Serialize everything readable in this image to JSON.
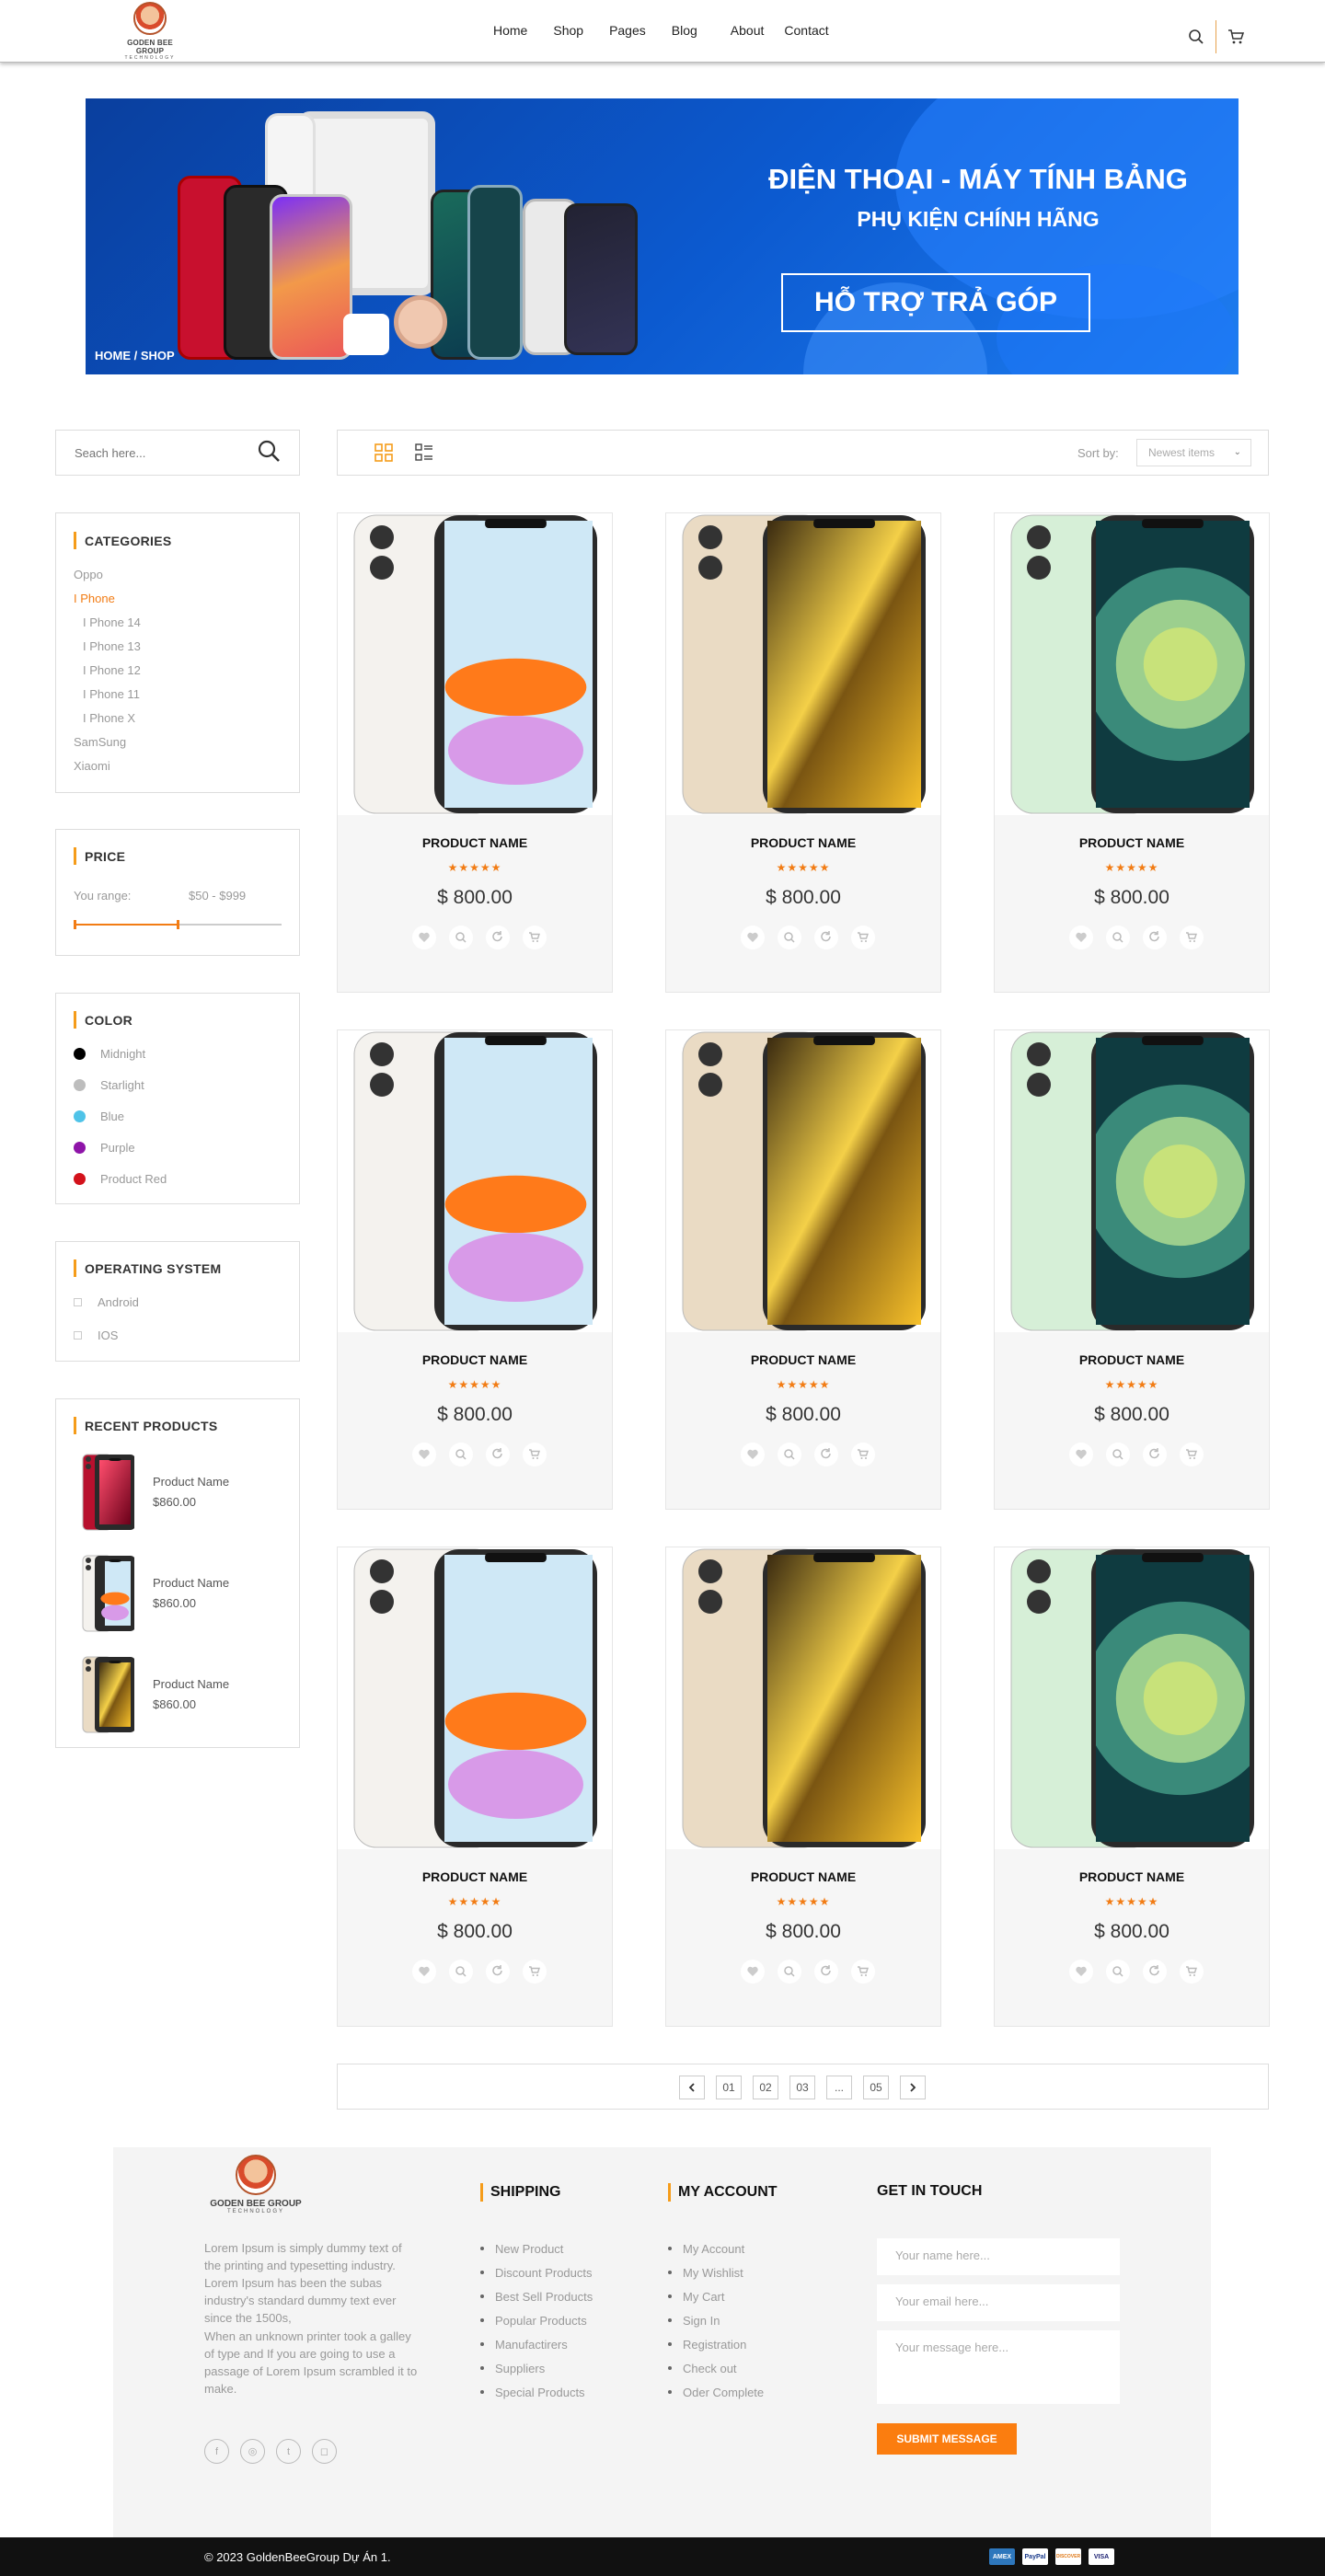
{
  "header": {
    "logo": {
      "name": "GODEN BEE GROUP",
      "sub": "TECHNOLOGY"
    },
    "nav": [
      "Home",
      "Shop",
      "Pages",
      "Blog",
      "About",
      "Contact"
    ]
  },
  "banner": {
    "title1": "ĐIỆN THOẠI - MÁY TÍNH BẢNG",
    "title2": "PHỤ KIỆN CHÍNH HÃNG",
    "button": "HỖ TRỢ TRẢ GÓP",
    "breadcrumb": "HOME / SHOP"
  },
  "search": {
    "placeholder": "Seach here..."
  },
  "categories": {
    "title": "CATEGORIES",
    "items": [
      {
        "label": "Oppo",
        "level": 0,
        "active": false
      },
      {
        "label": "I Phone",
        "level": 0,
        "active": true
      },
      {
        "label": "I Phone 14",
        "level": 1,
        "active": false
      },
      {
        "label": "I Phone 13",
        "level": 1,
        "active": false
      },
      {
        "label": "I Phone 12",
        "level": 1,
        "active": false
      },
      {
        "label": "I Phone 11",
        "level": 1,
        "active": false
      },
      {
        "label": "I Phone X",
        "level": 1,
        "active": false
      },
      {
        "label": "SamSung",
        "level": 0,
        "active": false
      },
      {
        "label": "Xiaomi",
        "level": 0,
        "active": false
      }
    ]
  },
  "price": {
    "title": "PRICE",
    "label": "You range:",
    "value": "$50 - $999",
    "slider_fraction": 0.5
  },
  "color": {
    "title": "COLOR",
    "items": [
      {
        "label": "Midnight",
        "color": "#000000"
      },
      {
        "label": "Starlight",
        "color": "#bdbdbd"
      },
      {
        "label": "Blue",
        "color": "#4fc3e8"
      },
      {
        "label": "Purple",
        "color": "#8e14a8"
      },
      {
        "label": "Product Red",
        "color": "#d3121b"
      }
    ]
  },
  "os": {
    "title": "OPERATING SYSTEM",
    "items": [
      "Android",
      "IOS"
    ]
  },
  "recent": {
    "title": "RECENT PRODUCTS",
    "items": [
      {
        "name": "Product Name",
        "price": "$860.00",
        "phone": "red"
      },
      {
        "name": "Product Name",
        "price": "$860.00",
        "phone": "white"
      },
      {
        "name": "Product Name",
        "price": "$860.00",
        "phone": "gold"
      }
    ]
  },
  "toolbar": {
    "sort_label": "Sort by:",
    "sort_value": "Newest items"
  },
  "products": [
    {
      "name": "PRODUCT NAME",
      "price": "$ 800.00",
      "stars": "★★★★★",
      "phone": "white"
    },
    {
      "name": "PRODUCT NAME",
      "price": "$ 800.00",
      "stars": "★★★★★",
      "phone": "gold"
    },
    {
      "name": "PRODUCT NAME",
      "price": "$ 800.00",
      "stars": "★★★★★",
      "phone": "green"
    },
    {
      "name": "PRODUCT NAME",
      "price": "$ 800.00",
      "stars": "★★★★★",
      "phone": "white"
    },
    {
      "name": "PRODUCT NAME",
      "price": "$ 800.00",
      "stars": "★★★★★",
      "phone": "gold"
    },
    {
      "name": "PRODUCT NAME",
      "price": "$ 800.00",
      "stars": "★★★★★",
      "phone": "green"
    },
    {
      "name": "PRODUCT NAME",
      "price": "$ 800.00",
      "stars": "★★★★★",
      "phone": "white"
    },
    {
      "name": "PRODUCT NAME",
      "price": "$ 800.00",
      "stars": "★★★★★",
      "phone": "gold"
    },
    {
      "name": "PRODUCT NAME",
      "price": "$ 800.00",
      "stars": "★★★★★",
      "phone": "green"
    }
  ],
  "pagination": [
    "01",
    "02",
    "03",
    "...",
    "05"
  ],
  "footer": {
    "logo": {
      "name": "GODEN BEE GROUP",
      "sub": "TECHNOLOGY"
    },
    "about1": "Lorem Ipsum is simply dummy text of the printing and typesetting industry. Lorem Ipsum has been the subas industry's standard dummy text ever since the 1500s,",
    "about2": "When an unknown printer took a galley of type and If you are going to use a passage of Lorem Ipsum scrambled it to make.",
    "shipping": {
      "title": "SHIPPING",
      "items": [
        "New Product",
        "Discount Products",
        "Best Sell Products",
        "Popular Products",
        "Manufactirers",
        "Suppliers",
        "Special Products"
      ]
    },
    "account": {
      "title": "MY ACCOUNT",
      "items": [
        "My Account",
        "My Wishlist",
        "My Cart",
        "Sign In",
        "Registration",
        "Check out",
        "Oder Complete"
      ]
    },
    "contact": {
      "title": "GET IN TOUCH",
      "name_ph": "Your name here...",
      "email_ph": "Your email here...",
      "msg_ph": "Your message here...",
      "button": "SUBMIT MESSAGE"
    },
    "copyright": "© 2023 GoldenBeeGroup Dự Án 1.",
    "payments": [
      "AMEX",
      "PayPal",
      "DISCOVER",
      "VISA"
    ]
  }
}
